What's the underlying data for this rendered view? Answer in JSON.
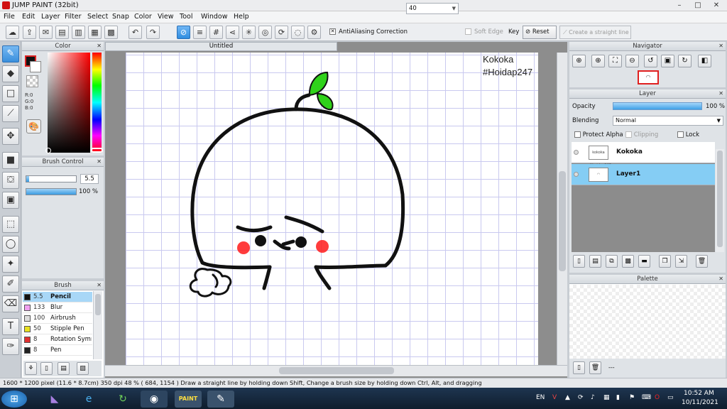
{
  "window": {
    "title": "JUMP PAINT (32bit)",
    "controls": [
      "–",
      "□",
      "✕"
    ]
  },
  "menu": [
    "File",
    "Edit",
    "Layer",
    "Filter",
    "Select",
    "Snap",
    "Color",
    "View",
    "Tool",
    "Window",
    "Help"
  ],
  "toolbar": {
    "antialiasing_label": "AntiAliasing",
    "correction_label": "Correction",
    "correction_value": "40",
    "soft_edge_label": "Soft Edge",
    "key_label": "Key",
    "reset_label": "Reset",
    "straight_line_label": "Create a straight line"
  },
  "color_panel": {
    "title": "Color",
    "r": "R:0",
    "g": "G:0",
    "b": "B:0",
    "fg": "#111111",
    "bg": "#ffffff"
  },
  "brush_control": {
    "title": "Brush Control",
    "size": "5.5",
    "size_fraction": 0.06,
    "opacity": "100 %",
    "opacity_fraction": 1.0
  },
  "brush_panel": {
    "title": "Brush",
    "items": [
      {
        "size": "5.5",
        "name": "Pencil",
        "color": "#111111",
        "selected": true
      },
      {
        "size": "133",
        "name": "Blur",
        "color": "#f0a0f0",
        "selected": false
      },
      {
        "size": "100",
        "name": "Airbrush",
        "color": "#dddddd",
        "selected": false
      },
      {
        "size": "50",
        "name": "Stipple Pen",
        "color": "#e8e020",
        "selected": false
      },
      {
        "size": "8",
        "name": "Rotation Symm",
        "color": "#e03030",
        "selected": false
      },
      {
        "size": "8",
        "name": "Pen",
        "color": "#222222",
        "selected": false
      }
    ]
  },
  "document": {
    "tab": "Untitled",
    "text_line1": "Kokoka",
    "text_line2": "#Hoidap247",
    "line_color": "#111111",
    "sprout_color": "#2fd21a",
    "blush_color": "#ff1a1a"
  },
  "navigator": {
    "title": "Navigator"
  },
  "layer_panel": {
    "title": "Layer",
    "opacity_label": "Opacity",
    "opacity_value": "100 %",
    "opacity_fraction": 1.0,
    "blending_label": "Blending",
    "blending_value": "Normal",
    "protect_alpha": "Protect Alpha",
    "clipping": "Clipping",
    "lock": "Lock",
    "layers": [
      {
        "name": "Kokoka",
        "thumb": "kokoka #hoidap247",
        "selected": false
      },
      {
        "name": "Layer1",
        "thumb": "◠",
        "selected": true
      }
    ]
  },
  "palette_panel": {
    "title": "Palette",
    "footer": "---"
  },
  "status": {
    "size": "1600 * 1200 pixel",
    "physical": "(11.6 * 8.7cm)",
    "dpi": "350 dpi",
    "zoom": "48 %",
    "coords": "( 684, 1154 )",
    "hint": "Draw a straight line by holding down Shift, Change a brush size by holding down Ctrl, Alt, and dragging"
  },
  "taskbar": {
    "lang": "EN",
    "time": "10:52 AM",
    "date": "10/11/2021"
  }
}
